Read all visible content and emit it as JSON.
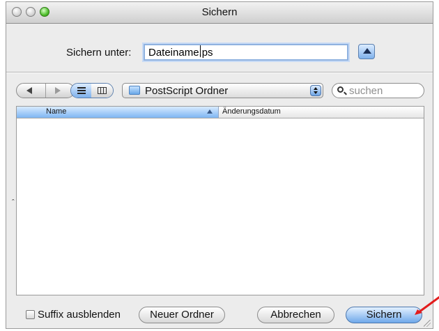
{
  "window": {
    "title": "Sichern"
  },
  "save_as": {
    "label": "Sichern unter:",
    "filename": "Dateiname.ps"
  },
  "toolbar": {
    "location": "PostScript Ordner",
    "search_placeholder": "suchen"
  },
  "browser": {
    "columns": [
      "Name",
      "Änderungsdatum"
    ],
    "sort_indicator": "▲",
    "rows": []
  },
  "footer": {
    "hide_suffix_label": "Suffix ausblenden",
    "new_folder_label": "Neuer Ordner",
    "cancel_label": "Abbrechen",
    "save_label": "Sichern"
  },
  "icons": {
    "close": "close-icon",
    "minimize": "minimize-icon",
    "zoom": "zoom-icon",
    "expand": "disclosure-up-icon",
    "back": "back-arrow-icon",
    "forward": "forward-arrow-icon",
    "list_view": "list-view-icon",
    "column_view": "column-view-icon",
    "folder": "folder-icon",
    "search": "search-icon",
    "annotation_arrow": "red-arrow-icon"
  },
  "colors": {
    "window_background": "#ececec",
    "accent_blue": "#7fb1ec",
    "arrow_red": "#e31c1c"
  }
}
